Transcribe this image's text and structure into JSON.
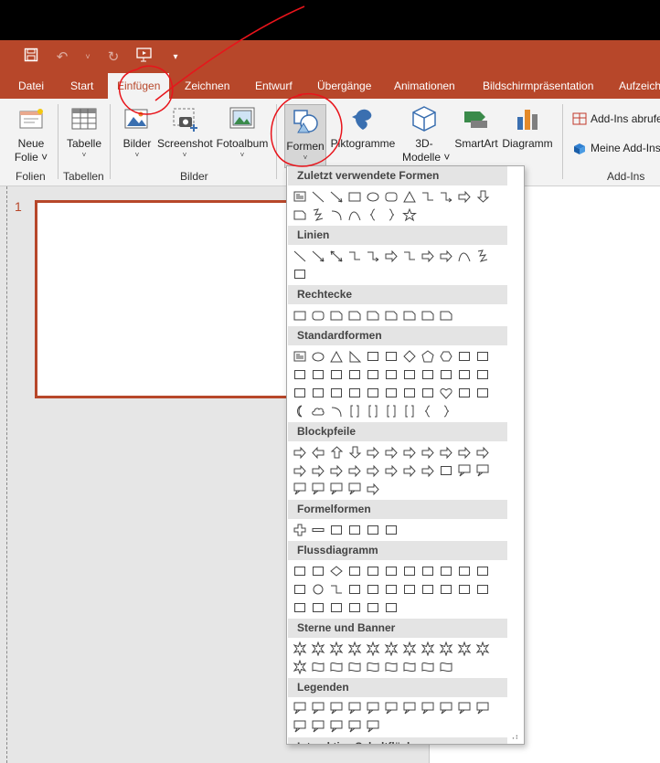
{
  "colors": {
    "accent": "#b7472a",
    "annotation": "#e8141b"
  },
  "qat": {
    "icons": [
      "save-icon",
      "undo-icon",
      "undo-dropdown-icon",
      "redo-icon",
      "start-slideshow-icon",
      "customize-qat-icon"
    ]
  },
  "tabs": {
    "file": "Datei",
    "home": "Start",
    "insert": "Einfügen",
    "draw": "Zeichnen",
    "design": "Entwurf",
    "transitions": "Übergänge",
    "animations": "Animationen",
    "slideshow": "Bildschirmpräsentation",
    "record": "Aufzeichnen"
  },
  "ribbon": {
    "new_slide": {
      "line1": "Neue",
      "line2": "Folie ˅"
    },
    "table": "Tabelle",
    "pictures": "Bilder",
    "screenshot": "Screenshot",
    "photo_album": "Fotoalbum",
    "shapes": "Formen",
    "icons": "Piktogramme",
    "models": {
      "line1": "3D-",
      "line2": "Modelle ˅"
    },
    "smartart": "SmartArt",
    "chart": "Diagramm",
    "get_addins": "Add-Ins abrufen",
    "my_addins": "Meine Add-Ins ˅",
    "groups": {
      "slides": "Folien",
      "tables": "Tabellen",
      "images": "Bilder",
      "addins": "Add-Ins"
    }
  },
  "slides": {
    "number": "1"
  },
  "shapes_menu": {
    "sections": [
      {
        "title": "Zuletzt verwendete Formen",
        "icons": [
          "textbox",
          "line",
          "arrow-line",
          "rectangle",
          "oval",
          "rounded-rectangle",
          "triangle",
          "elbow-connector",
          "elbow-arrow-connector",
          "right-arrow",
          "down-arrow",
          "pentagon-snip",
          "freeform",
          "arc",
          "curve",
          "left-brace",
          "right-brace",
          "star"
        ]
      },
      {
        "title": "Linien",
        "icons": [
          "line",
          "arrow-line",
          "double-arrow-line",
          "elbow-connector",
          "elbow-arrow-connector",
          "elbow-double-arrow",
          "curved-connector",
          "curved-arrow-connector",
          "curved-double-arrow",
          "curve",
          "freeform",
          "scribble"
        ]
      },
      {
        "title": "Rechtecke",
        "icons": [
          "rectangle",
          "rounded-rectangle",
          "snip-single-corner",
          "snip-same-side",
          "snip-diagonal",
          "snip-round",
          "round-single-corner",
          "round-same-side",
          "round-diagonal"
        ]
      },
      {
        "title": "Standardformen",
        "icons": [
          "textbox",
          "oval",
          "triangle",
          "right-triangle",
          "parallelogram",
          "trapezoid",
          "diamond",
          "pentagon",
          "hexagon",
          "heptagon",
          "octagon",
          "decagon",
          "dodecagon",
          "pie",
          "chord",
          "teardrop",
          "frame",
          "half-frame",
          "l-shape",
          "diagonal-stripe",
          "cross",
          "plaque",
          "can",
          "cube",
          "bevel",
          "donut",
          "no-symbol",
          "block-arc",
          "folded-corner",
          "smiley",
          "heart",
          "lightning",
          "sun",
          "moon",
          "cloud",
          "arc",
          "double-bracket",
          "double-brace",
          "left-bracket",
          "right-bracket",
          "left-brace",
          "right-brace"
        ]
      },
      {
        "title": "Blockpfeile",
        "icons": [
          "right-arrow",
          "left-arrow",
          "up-arrow",
          "down-arrow",
          "left-right-arrow",
          "up-down-arrow",
          "quad-arrow",
          "left-right-up-arrow",
          "bent-arrow",
          "u-turn-arrow",
          "left-up-arrow",
          "bent-up-arrow",
          "curved-right-arrow",
          "curved-left-arrow",
          "curved-up-arrow",
          "curved-down-arrow",
          "striped-right-arrow",
          "notched-right-arrow",
          "pentagon-arrow",
          "chevron",
          "right-arrow-callout",
          "down-arrow-callout",
          "left-arrow-callout",
          "up-arrow-callout",
          "left-right-arrow-callout",
          "quad-arrow-callout",
          "circular-arrow"
        ]
      },
      {
        "title": "Formelformen",
        "icons": [
          "plus",
          "minus",
          "multiply",
          "divide",
          "equal",
          "not-equal"
        ]
      },
      {
        "title": "Flussdiagramm",
        "icons": [
          "process",
          "alternate-process",
          "decision",
          "data",
          "predefined-process",
          "internal-storage",
          "document",
          "multidocument",
          "terminator",
          "preparation",
          "manual-input",
          "manual-operation",
          "connector",
          "offpage-connector",
          "card",
          "punched-tape",
          "summing-junction",
          "or",
          "collate",
          "sort",
          "extract",
          "merge",
          "stored-data",
          "delay",
          "sequential-access",
          "magnetic-disk",
          "direct-access",
          "display"
        ]
      },
      {
        "title": "Sterne und Banner",
        "icons": [
          "explosion-1",
          "explosion-2",
          "star-4",
          "star-5",
          "star-6",
          "star-7",
          "star-8",
          "star-10",
          "star-12",
          "star-16",
          "star-24",
          "star-32",
          "ribbon-up",
          "ribbon-down",
          "curved-ribbon-up",
          "curved-ribbon-down",
          "vertical-scroll",
          "horizontal-scroll",
          "wave",
          "double-wave"
        ]
      },
      {
        "title": "Legenden",
        "icons": [
          "rectangular-callout",
          "rounded-callout",
          "oval-callout",
          "cloud-callout",
          "line-callout-1",
          "line-callout-2",
          "line-callout-3",
          "line-callout-4",
          "line-callout-1-accent",
          "line-callout-2-accent",
          "line-callout-3-accent",
          "line-callout-4-accent",
          "line-callout-1-noborder",
          "line-callout-2-noborder",
          "line-callout-3-noborder",
          "line-callout-4-noborder"
        ]
      },
      {
        "title": "Interaktive Schaltflächen",
        "icons": [
          "action-back",
          "action-forward",
          "action-beginning",
          "action-end",
          "action-home",
          "action-information",
          "action-return",
          "action-movie",
          "action-document",
          "action-sound",
          "action-help",
          "action-custom"
        ]
      }
    ]
  }
}
